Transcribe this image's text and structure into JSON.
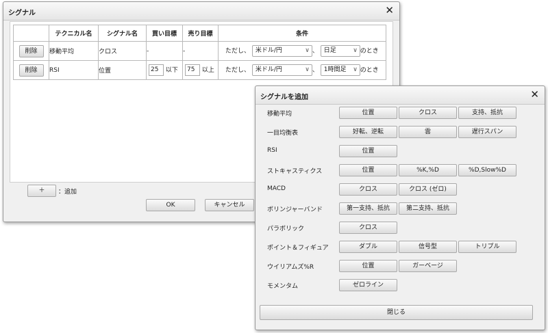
{
  "main_dialog": {
    "title": "シグナル",
    "close": "✕",
    "columns": [
      "",
      "テクニカル名",
      "シグナル名",
      "買い目標",
      "売り目標",
      "条件"
    ],
    "rows": [
      {
        "delete_label": "削除",
        "technical": "移動平均",
        "signal": "クロス",
        "buy": "-",
        "sell": "-",
        "cond_prefix": "ただし、",
        "currency": "米ドル/円",
        "sep": "、",
        "period": "日足",
        "cond_suffix": "のとき"
      },
      {
        "delete_label": "削除",
        "technical": "RSI",
        "signal": "位置",
        "buy_value": "25",
        "buy_suffix": "以下",
        "sell_value": "75",
        "sell_suffix": "以上",
        "cond_prefix": "ただし、",
        "currency": "米ドル/円",
        "sep": "、",
        "period": "1時間足",
        "cond_suffix": "のとき"
      }
    ],
    "add_button": "＋",
    "add_label": "：追加",
    "ok": "OK",
    "cancel": "キャンセル",
    "select_chevron": "∨"
  },
  "add_dialog": {
    "title": "シグナルを追加",
    "close": "✕",
    "groups": [
      {
        "label": "移動平均",
        "options": [
          "位置",
          "クロス",
          "支持、抵抗"
        ]
      },
      {
        "label": "一目均衡表",
        "options": [
          "好転、逆転",
          "雲",
          "遅行スパン"
        ]
      },
      {
        "label": "RSI",
        "options": [
          "位置"
        ]
      },
      {
        "label": "ストキャスティクス",
        "options": [
          "位置",
          "%K,%D",
          "%D,Slow%D"
        ]
      },
      {
        "label": "MACD",
        "options": [
          "クロス",
          "クロス (ゼロ)"
        ]
      },
      {
        "label": "ボリンジャーバンド",
        "options": [
          "第一支持、抵抗",
          "第二支持、抵抗"
        ]
      },
      {
        "label": "パラボリック",
        "options": [
          "クロス"
        ]
      },
      {
        "label": "ポイント＆フィギュア",
        "options": [
          "ダブル",
          "信号型",
          "トリプル"
        ]
      },
      {
        "label": "ウイリアムズ%R",
        "options": [
          "位置",
          "ガーベージ"
        ]
      },
      {
        "label": "モメンタム",
        "options": [
          "ゼロライン"
        ]
      }
    ],
    "close_button": "閉じる"
  }
}
